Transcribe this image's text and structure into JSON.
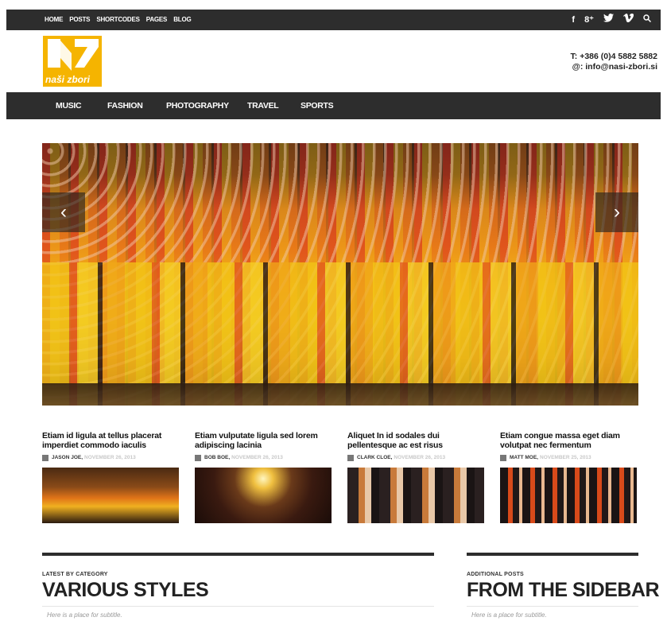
{
  "topbar": {
    "nav": [
      "HOME",
      "POSTS",
      "SHORTCODES",
      "PAGES",
      "BLOG"
    ],
    "social_icons": [
      "facebook-icon",
      "google-plus-icon",
      "twitter-icon",
      "vimeo-icon",
      "search-icon"
    ],
    "social_glyphs": [
      "f",
      "8⁺",
      "t",
      "v",
      "⚲"
    ]
  },
  "header": {
    "logo_text": "naši zbori",
    "phone": "T: +386 (0)4 5882 5882",
    "email": "@: info@nasi-zbori.si"
  },
  "mainnav": [
    "MUSIC",
    "FASHION",
    "PHOTOGRAPHY",
    "TRAVEL",
    "SPORTS"
  ],
  "slider": {
    "prev_glyph": "‹",
    "next_glyph": "›"
  },
  "posts": [
    {
      "title": "Etiam id ligula at tellus placerat imperdiet commodo iaculis",
      "author": "JASON JOE,",
      "date": "NOVEMBER 26, 2013"
    },
    {
      "title": "Etiam vulputate ligula sed lorem adipiscing lacinia",
      "author": "BOB BOE,",
      "date": "NOVEMBER 26, 2013"
    },
    {
      "title": "Aliquet In id sodales dui pellentesque ac est risus",
      "author": "CLARK CLOE,",
      "date": "NOVEMBER 26, 2013"
    },
    {
      "title": "Etiam congue massa eget diam volutpat nec fermentum",
      "author": "MATT MOE,",
      "date": "NOVEMBER 25, 2013"
    }
  ],
  "sections": {
    "main": {
      "kicker": "LATEST BY CATEGORY",
      "title": "VARIOUS STYLES",
      "subtitle": "Here is a place for subtitle."
    },
    "sidebar": {
      "kicker": "ADDITIONAL POSTS",
      "title": "FROM THE SIDEBAR",
      "subtitle": "Here is a place for subtitle."
    }
  },
  "colors": {
    "dark_bar": "#2d2d2d",
    "logo_yellow": "#f5b400",
    "date_grey": "#c8c8c8"
  }
}
